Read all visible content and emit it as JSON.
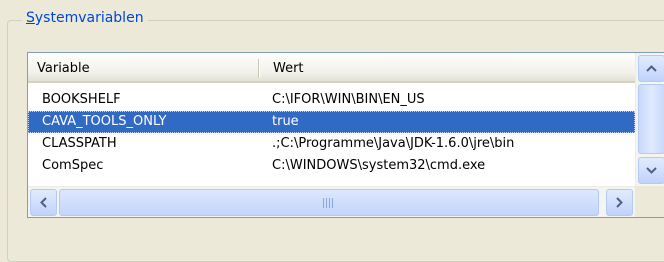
{
  "group": {
    "title_accel": "S",
    "title_rest": "ystemvariablen"
  },
  "columns": {
    "variable": "Variable",
    "value": "Wert"
  },
  "rows": [
    {
      "name": "BOOKSHELF",
      "value": "C:\\IFOR\\WIN\\BIN\\EN_US",
      "selected": false
    },
    {
      "name": "CAVA_TOOLS_ONLY",
      "value": "true",
      "selected": true
    },
    {
      "name": "CLASSPATH",
      "value": ".;C:\\Programme\\Java\\JDK-1.6.0\\jre\\bin",
      "selected": false
    },
    {
      "name": "ComSpec",
      "value": "C:\\WINDOWS\\system32\\cmd.exe",
      "selected": false
    }
  ],
  "colors": {
    "selection": "#316ac5",
    "group_title": "#0046d5",
    "arrow": "#4d6185"
  }
}
